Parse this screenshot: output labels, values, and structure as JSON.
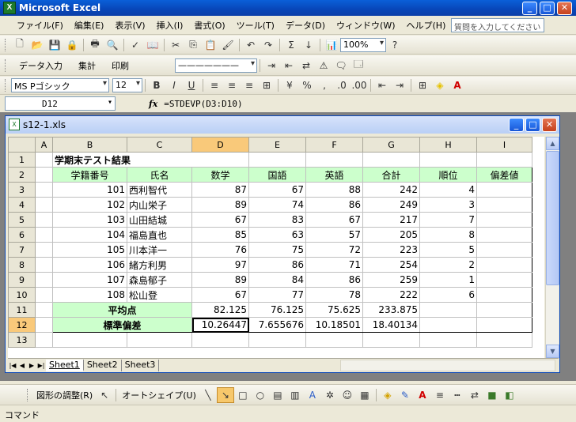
{
  "app": {
    "title": "Microsoft Excel",
    "icon_letter": "X"
  },
  "menu": [
    "ファイル(F)",
    "編集(E)",
    "表示(V)",
    "挿入(I)",
    "書式(O)",
    "ツール(T)",
    "データ(D)",
    "ウィンドウ(W)",
    "ヘルプ(H)"
  ],
  "help_placeholder": "質問を入力してください",
  "toolbar": {
    "zoom": "100%",
    "data_input": "データ入力",
    "total": "集計",
    "print": "印刷"
  },
  "format": {
    "font": "MS Pゴシック",
    "size": "12",
    "bold": "B",
    "italic": "I",
    "underline": "U",
    "percent": "%",
    "comma": ","
  },
  "formula_bar": {
    "name_box": "D12",
    "fx": "fx",
    "formula": "=STDEVP(D3:D10)"
  },
  "workbook": {
    "title": "s12-1.xls"
  },
  "sheet": {
    "columns": [
      "A",
      "B",
      "C",
      "D",
      "E",
      "F",
      "G",
      "H",
      "I"
    ],
    "title": "学期末テスト結果",
    "headers": [
      "学籍番号",
      "氏名",
      "数学",
      "国語",
      "英語",
      "合計",
      "順位",
      "偏差値"
    ],
    "rows": [
      {
        "id": "101",
        "name": "西利智代",
        "math": "87",
        "jp": "67",
        "en": "88",
        "total": "242",
        "rank": "4"
      },
      {
        "id": "102",
        "name": "内山栄子",
        "math": "89",
        "jp": "74",
        "en": "86",
        "total": "249",
        "rank": "3"
      },
      {
        "id": "103",
        "name": "山田結城",
        "math": "67",
        "en": "67",
        "jp": "83",
        "total": "217",
        "rank": "7"
      },
      {
        "id": "104",
        "name": "福島直也",
        "math": "85",
        "jp": "63",
        "en": "57",
        "total": "205",
        "rank": "8"
      },
      {
        "id": "105",
        "name": "川本洋一",
        "math": "76",
        "jp": "75",
        "en": "72",
        "total": "223",
        "rank": "5"
      },
      {
        "id": "106",
        "name": "緒方利男",
        "math": "97",
        "jp": "86",
        "en": "71",
        "total": "254",
        "rank": "2"
      },
      {
        "id": "107",
        "name": "森島郁子",
        "math": "89",
        "jp": "84",
        "en": "86",
        "total": "259",
        "rank": "1"
      },
      {
        "id": "108",
        "name": "松山登",
        "math": "67",
        "jp": "77",
        "en": "78",
        "total": "222",
        "rank": "6"
      }
    ],
    "avg_label": "平均点",
    "avg": [
      "82.125",
      "76.125",
      "75.625",
      "233.875"
    ],
    "std_label": "標準偏差",
    "std": [
      "10.26447",
      "7.655676",
      "10.18501",
      "18.40134"
    ]
  },
  "tabs": [
    "Sheet1",
    "Sheet2",
    "Sheet3"
  ],
  "draw": {
    "adjust": "図形の調整(R)",
    "autoshape": "オートシェイプ(U)"
  },
  "status": "コマンド"
}
